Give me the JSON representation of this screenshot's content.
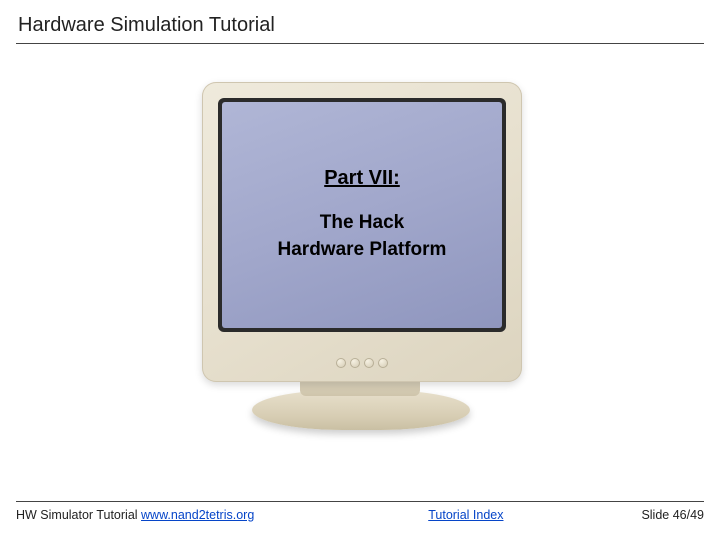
{
  "header": {
    "title": "Hardware Simulation Tutorial"
  },
  "slide": {
    "part_label": "Part VII:",
    "line1": "The Hack",
    "line2": "Hardware Platform"
  },
  "footer": {
    "left_prefix": "HW Simulator Tutorial ",
    "left_link": "www.nand2tetris.org",
    "center_link": "Tutorial Index",
    "right_text": "Slide 46/49"
  }
}
